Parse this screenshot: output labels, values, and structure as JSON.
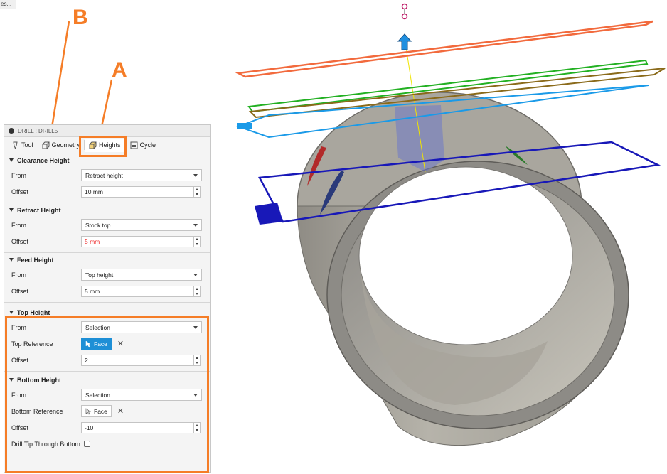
{
  "topleft_chip": "es...",
  "panel": {
    "title": "DRILL : DRILL5",
    "tabs": [
      {
        "label": "Tool",
        "icon": "tool-icon",
        "active": false
      },
      {
        "label": "Geometry",
        "icon": "geometry-icon",
        "active": false
      },
      {
        "label": "Heights",
        "icon": "heights-icon",
        "active": true
      },
      {
        "label": "Cycle",
        "icon": "cycle-icon",
        "active": false
      }
    ],
    "sections": {
      "clearance": {
        "title": "Clearance Height",
        "from_label": "From",
        "from_value": "Retract height",
        "offset_label": "Offset",
        "offset_value": "10 mm"
      },
      "retract": {
        "title": "Retract Height",
        "from_label": "From",
        "from_value": "Stock top",
        "offset_label": "Offset",
        "offset_value": "5 mm"
      },
      "feed": {
        "title": "Feed Height",
        "from_label": "From",
        "from_value": "Top height",
        "offset_label": "Offset",
        "offset_value": "5 mm"
      },
      "top": {
        "title": "Top Height",
        "from_label": "From",
        "from_value": "Selection",
        "ref_label": "Top Reference",
        "ref_value": "Face",
        "offset_label": "Offset",
        "offset_value": "2"
      },
      "bottom": {
        "title": "Bottom Height",
        "from_label": "From",
        "from_value": "Selection",
        "ref_label": "Bottom Reference",
        "ref_value": "Face",
        "offset_label": "Offset",
        "offset_value": "-10",
        "drill_tip_label": "Drill Tip Through Bottom"
      }
    }
  },
  "annotations": {
    "a": "A",
    "b": "B"
  },
  "colors": {
    "annotation": "#f57d27",
    "selected_button": "#1e8fd6",
    "clearance_plane": "#f26a3d",
    "retract_plane": "#22b022",
    "feed_plane": "#8a6a1a",
    "top_plane": "#1a9ae8",
    "bottom_plane": "#1818b8"
  }
}
